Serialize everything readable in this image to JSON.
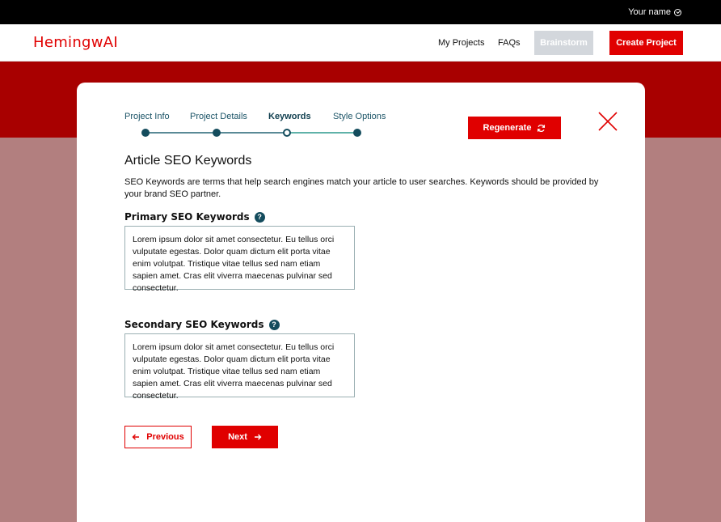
{
  "topbar": {
    "username": "Your name"
  },
  "nav": {
    "logo": "HemingwAI",
    "links": [
      "My Projects",
      "FAQs"
    ],
    "brainstorm": "Brainstorm",
    "create_project": "Create Project"
  },
  "stepper": {
    "steps": [
      "Project Info",
      "Project Details",
      "Keywords",
      "Style Options"
    ],
    "current_step": "Keywords"
  },
  "regenerate_label": "Regenerate",
  "page": {
    "title": "Article SEO Keywords",
    "description": "SEO Keywords are terms that help search engines match your article to user searches. Keywords should be provided by your brand SEO partner."
  },
  "fields": {
    "primary": {
      "label": "Primary SEO Keywords",
      "help": "?",
      "value": "Lorem ipsum dolor sit amet consectetur. Eu tellus orci vulputate egestas. Dolor quam dictum elit porta vitae enim volutpat. Tristique vitae tellus sed nam etiam sapien amet. Cras elit viverra maecenas pulvinar sed consectetur."
    },
    "secondary": {
      "label": "Secondary SEO Keywords",
      "help": "?",
      "value": "Lorem ipsum dolor sit amet consectetur. Eu tellus orci vulputate egestas. Dolor quam dictum elit porta vitae enim volutpat. Tristique vitae tellus sed nam etiam sapien amet. Cras elit viverra maecenas pulvinar sed consectetur."
    }
  },
  "buttons": {
    "previous": "Previous",
    "next": "Next"
  },
  "colors": {
    "brand_red": "#e00000",
    "teal": "#144c5d",
    "disabled_gray": "#d3d7dc"
  }
}
